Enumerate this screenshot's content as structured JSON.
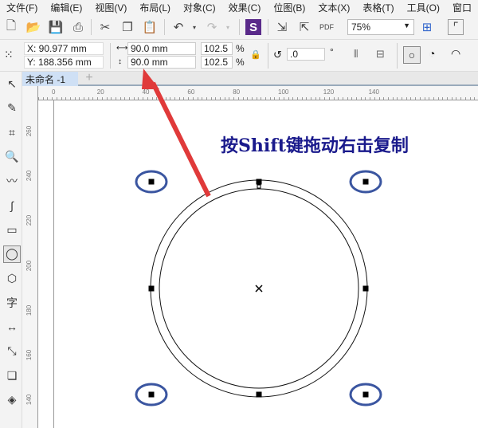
{
  "menu": [
    "文件(F)",
    "编辑(E)",
    "视图(V)",
    "布局(L)",
    "对象(C)",
    "效果(C)",
    "位图(B)",
    "文本(X)",
    "表格(T)",
    "工具(O)",
    "窗口"
  ],
  "toolbar": {
    "zoom": "75%"
  },
  "props": {
    "x": "X: 90.977 mm",
    "y": "Y: 188.356 mm",
    "w": "90.0 mm",
    "h": "90.0 mm",
    "sw": "102.5",
    "sh": "102.5",
    "pct": "%",
    "angle": ".0",
    "deg": "°"
  },
  "tabs": {
    "doc": "未命名 -1",
    "add": "+"
  },
  "rulers": {
    "h": [
      "0",
      "20",
      "40",
      "60",
      "80",
      "100",
      "120",
      "140"
    ],
    "v": [
      "260",
      "240",
      "220",
      "200",
      "180",
      "160",
      "140"
    ]
  },
  "annotation": {
    "text": "按Shift键拖动右击复制",
    "color": "#1a1a8c",
    "ellipse_color": "#3a55a0",
    "arrow_color": "#e03a3a"
  },
  "tools": [
    "pick",
    "shape",
    "crop",
    "zoom",
    "freehand",
    "artistic-media",
    "rectangle",
    "ellipse",
    "polygon",
    "text",
    "dimension",
    "connector",
    "drop-shadow",
    "fill"
  ],
  "tool_glyphs": [
    "↖",
    "✎",
    "⌗",
    "🔍",
    "〰",
    "∫",
    "▭",
    "◯",
    "⬡",
    "字",
    "↔",
    "⤡",
    "❏",
    "◈"
  ]
}
